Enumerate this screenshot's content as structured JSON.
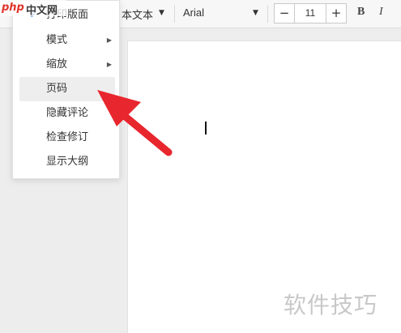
{
  "toolbar": {
    "paragraph_style": "本文本",
    "font": "Arial",
    "font_size": "11",
    "minus": "−",
    "plus": "+",
    "bold": "B",
    "italic": "I"
  },
  "menu": {
    "items": [
      {
        "label": "打印版面",
        "checked": true,
        "submenu": false
      },
      {
        "label": "模式",
        "checked": false,
        "submenu": true
      },
      {
        "label": "缩放",
        "checked": false,
        "submenu": true
      },
      {
        "label": "页码",
        "checked": false,
        "submenu": false,
        "highlighted": true
      },
      {
        "label": "隐藏评论",
        "checked": false,
        "submenu": false
      },
      {
        "label": "检查修订",
        "checked": false,
        "submenu": false
      },
      {
        "label": "显示大纲",
        "checked": false,
        "submenu": false
      }
    ]
  },
  "logo": {
    "php": "php",
    "cn": "中文网"
  },
  "watermark": "软件技巧",
  "colors": {
    "arrow": "#e8262d",
    "check": "#4a90d9",
    "logo_red": "#e0352b"
  },
  "icons": {
    "check": "check-icon",
    "submenu": "chevron-right-icon",
    "arrow": "pointer-arrow-icon"
  }
}
